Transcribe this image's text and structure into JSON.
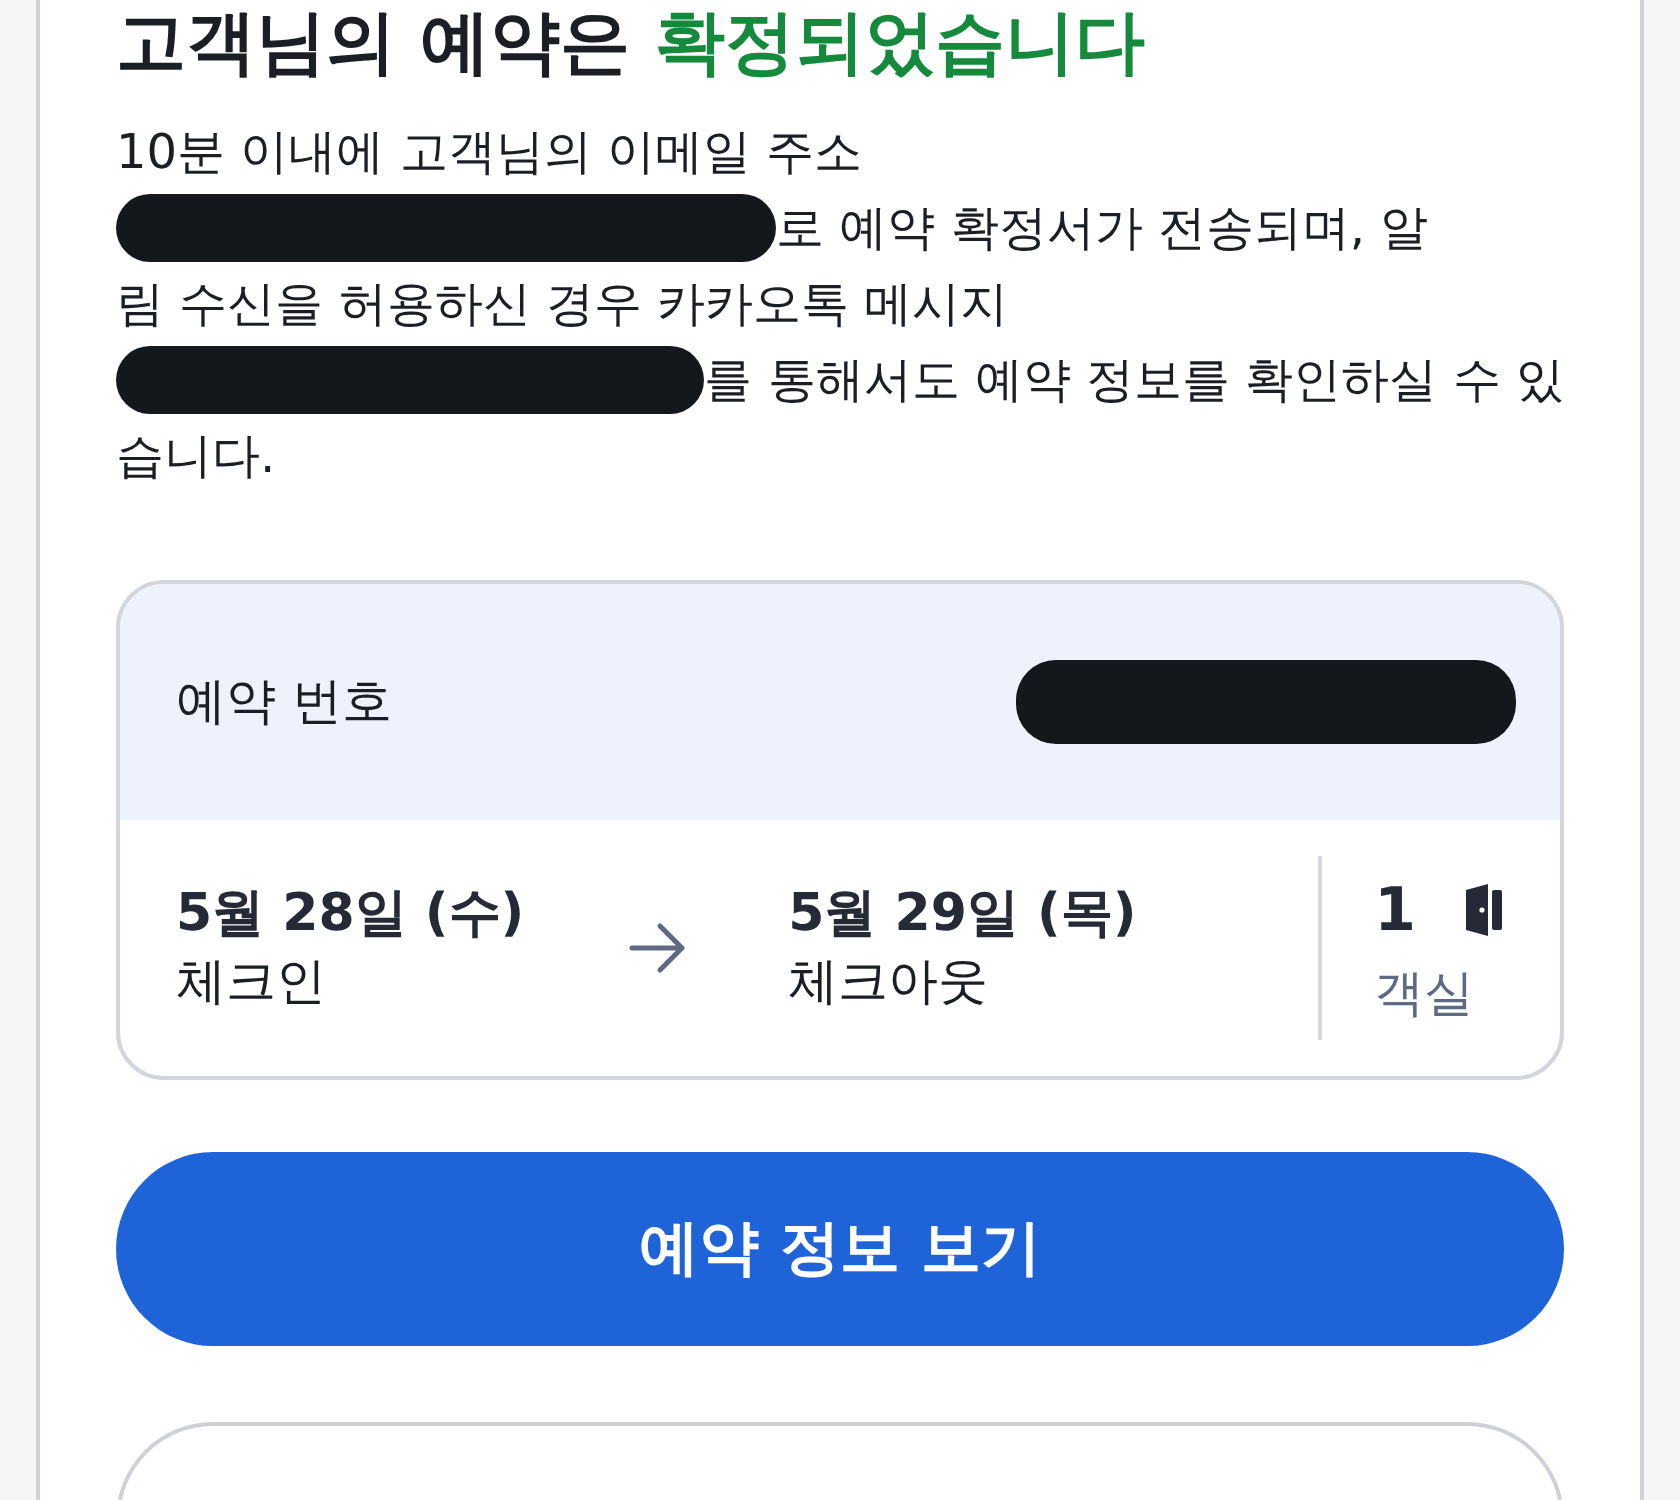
{
  "title": {
    "text": "고객님의 예약은 ",
    "highlight": "확정되었습니다"
  },
  "message_lines": [
    {
      "redacted": false,
      "text": "10분 이내에 고객님의 이메일 주소"
    },
    {
      "redacted": true,
      "text": "로 예약 확정서가 전송되며, 알"
    },
    {
      "redacted": false,
      "text": "림 수신을 허용하신 경우 카카오톡 메시지"
    },
    {
      "redacted": true,
      "text": "를 통해서도 예약 정보를 확인하실 수 있"
    },
    {
      "redacted": false,
      "text": "습니다."
    }
  ],
  "booking": {
    "number_label": "예약 번호",
    "number_redacted": true,
    "checkin": {
      "date": "5월 28일 (수)",
      "label": "체크인"
    },
    "checkout": {
      "date": "5월 29일 (목)",
      "label": "체크아웃"
    },
    "rooms": {
      "count": "1",
      "label": "객실"
    }
  },
  "buttons": [
    {
      "kind": "primary",
      "label": "예약 정보 보기"
    },
    {
      "kind": "outline"
    }
  ]
}
